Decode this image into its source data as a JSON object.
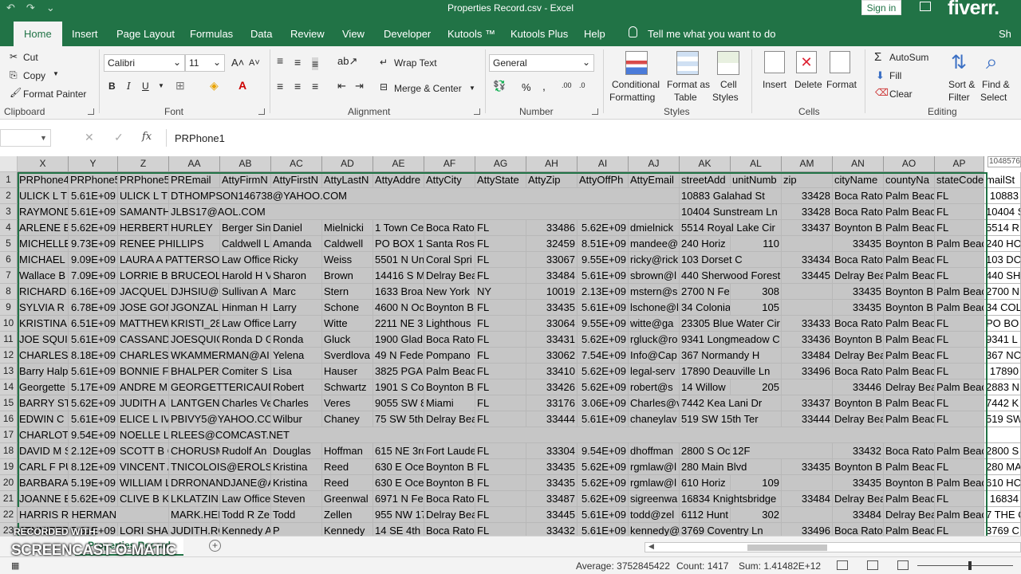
{
  "window": {
    "title": "Properties Record.csv  -  Excel",
    "signin": "Sign in",
    "brand_logo": "fiverr."
  },
  "tabs": [
    {
      "label": "Home",
      "active": true
    },
    {
      "label": "Insert"
    },
    {
      "label": "Page Layout"
    },
    {
      "label": "Formulas"
    },
    {
      "label": "Data"
    },
    {
      "label": "Review"
    },
    {
      "label": "View"
    },
    {
      "label": "Developer"
    },
    {
      "label": "Kutools ™"
    },
    {
      "label": "Kutools Plus"
    },
    {
      "label": "Help"
    }
  ],
  "tell_me": "Tell me what you want to do",
  "share": "Sh",
  "ribbon": {
    "clipboard": {
      "label": "Clipboard",
      "cut": "Cut",
      "copy": "Copy",
      "format_painter": "Format Painter"
    },
    "font": {
      "label": "Font",
      "name": "Calibri",
      "size": "11",
      "bold": "B",
      "italic": "I",
      "underline": "U"
    },
    "alignment": {
      "label": "Alignment",
      "wrap": "Wrap Text",
      "merge": "Merge & Center"
    },
    "number": {
      "label": "Number",
      "format": "General",
      "percent": "%",
      "comma": ","
    },
    "styles": {
      "label": "Styles",
      "conditional": "Conditional",
      "conditional2": "Formatting",
      "format_as": "Format as",
      "format_as2": "Table",
      "cell_styles": "Cell",
      "cell_styles2": "Styles"
    },
    "cells": {
      "label": "Cells",
      "insert": "Insert",
      "delete": "Delete",
      "format": "Format"
    },
    "editing": {
      "label": "Editing",
      "autosum": "AutoSum",
      "fill": "Fill",
      "clear": "Clear",
      "sort": "Sort &",
      "sort2": "Filter",
      "find": "Find &",
      "find2": "Select"
    }
  },
  "formula_bar": {
    "fx": "fx",
    "value": "PRPhone1"
  },
  "columns": [
    "X",
    "Y",
    "Z",
    "AA",
    "AB",
    "AC",
    "AD",
    "AE",
    "AF",
    "AG",
    "AH",
    "AI",
    "AJ",
    "AK",
    "AL",
    "AM",
    "AN",
    "AO",
    "AP"
  ],
  "rows": [
    {
      "n": "1",
      "c": [
        "PRPhone4",
        "PRPhone5",
        "PRPhone5",
        "PREmail",
        "AttyFirmN",
        "AttyFirstN",
        "AttyLastN",
        "AttyAddre",
        "AttyCity",
        "AttyState",
        "AttyZip",
        "AttyOffPh",
        "AttyEmail",
        "streetAdd",
        "unitNumb",
        "zip",
        "cityName",
        "countyNa",
        "stateCode",
        "mailSt"
      ]
    },
    {
      "n": "2",
      "c": [
        "ULICK L TH",
        "5.61E+09",
        "ULICK L TH",
        "DTHOMPSON146738@YAHOO.COM",
        "",
        "",
        "",
        "",
        "",
        "",
        "",
        "",
        "",
        "10883 Galahad St",
        "",
        "33428",
        "Boca Rato",
        "Palm Beac",
        "FL",
        "10883"
      ]
    },
    {
      "n": "3",
      "c": [
        "RAYMOND",
        "5.61E+09",
        "SAMANTH",
        "JLBS17@AOL.COM",
        "",
        "",
        "",
        "",
        "",
        "",
        "",
        "",
        "",
        "10404 Sunstream Ln",
        "",
        "33428",
        "Boca Rato",
        "Palm Beac",
        "FL",
        "10404 S"
      ]
    },
    {
      "n": "4",
      "c": [
        "ARLENE B",
        "5.62E+09",
        "HERBERT C",
        "HURLEY",
        "Berger Sin",
        "Daniel",
        "Mielnicki",
        "1 Town Ce",
        "Boca Rato",
        "FL",
        "33486",
        "5.62E+09",
        "dmielnick",
        "5514 Royal Lake Cir",
        "",
        "33437",
        "Boynton B",
        "Palm Beac",
        "FL",
        "5514 R"
      ]
    },
    {
      "n": "5",
      "c": [
        "MICHELLE",
        "9.73E+09",
        "RENEE PHILLIPS",
        "",
        "Caldwell L",
        "Amanda",
        "Caldwell",
        "PO BOX 18",
        "Santa Ros",
        "FL",
        "32459",
        "8.51E+09",
        "mandee@",
        "240 Horiz",
        "110",
        "",
        "33435",
        "Boynton B",
        "Palm Beac",
        "FL",
        "240 HO"
      ]
    },
    {
      "n": "6",
      "c": [
        "MICHAEL S",
        "9.09E+09",
        "LAURA A PATTERSON",
        "",
        "Law Office",
        "Ricky",
        "Weiss",
        "5501 N Un",
        "Coral Spri",
        "FL",
        "33067",
        "9.55E+09",
        "ricky@rick",
        "103 Dorset C",
        "",
        "33434",
        "Boca Rato",
        "Palm Beac",
        "FL",
        "103 DC"
      ]
    },
    {
      "n": "7",
      "c": [
        "Wallace B",
        "7.09E+09",
        "LORRIE B BRUCEOLS",
        "",
        "Harold H V",
        "Sharon",
        "Brown",
        "14416 S M",
        "Delray Bea",
        "FL",
        "33484",
        "5.61E+09",
        "sbrown@l",
        "440 Sherwood Forest",
        "",
        "33445",
        "Delray Bea",
        "Palm Beac",
        "FL",
        "440 SH"
      ]
    },
    {
      "n": "8",
      "c": [
        "RICHARD V",
        "6.16E+09",
        "JACQUELI",
        "DJHSIU@C",
        "Sullivan A",
        "Marc",
        "Stern",
        "1633 Broa",
        "New York",
        "NY",
        "10019",
        "2.13E+09",
        "mstern@s",
        "2700 N Fe",
        "308",
        "",
        "33435",
        "Boynton B",
        "Palm Beac",
        "FL",
        "2700 N"
      ]
    },
    {
      "n": "9",
      "c": [
        "SYLVIA R C",
        "6.78E+09",
        "JOSE GON",
        "JGONZALE",
        "Hinman H",
        "Larry",
        "Schone",
        "4600 N Oc",
        "Boynton B",
        "FL",
        "33435",
        "5.61E+09",
        "lschone@l",
        "34 Colonia",
        "105",
        "",
        "33435",
        "Boynton B",
        "Palm Beac",
        "FL",
        "34 COL"
      ]
    },
    {
      "n": "10",
      "c": [
        "KRISTINA",
        "6.51E+09",
        "MATTHEW",
        "KRISTI_28",
        "Law Office",
        "Larry",
        "Witte",
        "2211 NE 3",
        "Lighthous",
        "FL",
        "33064",
        "9.55E+09",
        "witte@ga",
        "23305 Blue Water Cir",
        "",
        "33433",
        "Boca Rato",
        "Palm Beac",
        "FL",
        "PO BO"
      ]
    },
    {
      "n": "11",
      "c": [
        "JOE SQUIC",
        "5.61E+09",
        "CASSANDI",
        "JOESQUIC",
        "Ronda D G",
        "Ronda",
        "Gluck",
        "1900 Glad",
        "Boca Rato",
        "FL",
        "33431",
        "5.62E+09",
        "rgluck@ro",
        "9341 Longmeadow C",
        "",
        "33436",
        "Boynton B",
        "Palm Beac",
        "FL",
        "9341 L"
      ]
    },
    {
      "n": "12",
      "c": [
        "CHARLES J",
        "8.18E+09",
        "CHARLES J",
        "WKAMMERMAN@AI",
        "",
        "Yelena",
        "Sverdlova",
        "49 N Fede",
        "Pompano",
        "FL",
        "33062",
        "7.54E+09",
        "Info@Cap",
        "367 Normandy H",
        "",
        "33484",
        "Delray Bea",
        "Palm Beac",
        "FL",
        "367 NC"
      ]
    },
    {
      "n": "13",
      "c": [
        "Barry Halp",
        "5.61E+09",
        "BONNIE F",
        "BHALPERI",
        "Comiter S",
        "Lisa",
        "Hauser",
        "3825 PGA",
        "Palm Beac",
        "FL",
        "33410",
        "5.62E+09",
        "legal-serv",
        "17890 Deauville Ln",
        "",
        "33496",
        "Boca Rato",
        "Palm Beac",
        "FL",
        "17890"
      ]
    },
    {
      "n": "14",
      "c": [
        "Georgette",
        "5.17E+09",
        "ANDRE M",
        "GEORGETTERICAUD@",
        "",
        "Robert",
        "Schwartz",
        "1901 S Cor",
        "Boynton B",
        "FL",
        "33426",
        "5.62E+09",
        "robert@s",
        "14 Willow",
        "205",
        "",
        "33446",
        "Delray Bea",
        "Palm Beac",
        "FL",
        "2883 N"
      ]
    },
    {
      "n": "15",
      "c": [
        "BARRY STE",
        "5.62E+09",
        "JUDITH A",
        "LANTGENI",
        "Charles Ve",
        "Charles",
        "Veres",
        "9055 SW 8",
        "Miami",
        "FL",
        "33176",
        "3.06E+09",
        "Charles@v",
        "7442 Kea Lani Dr",
        "",
        "33437",
        "Boynton B",
        "Palm Beac",
        "FL",
        "7442 K"
      ]
    },
    {
      "n": "16",
      "c": [
        "EDWIN C I",
        "5.61E+09",
        "ELICE L IVY",
        "PBIVY5@YAHOO.COM",
        "",
        "Wilbur",
        "Chaney",
        "75 SW 5th",
        "Delray Bea",
        "FL",
        "33444",
        "5.61E+09",
        "chaneylav",
        "519 SW 15th Ter",
        "",
        "33444",
        "Delray Bea",
        "Palm Beac",
        "FL",
        "519 SW"
      ]
    },
    {
      "n": "17",
      "c": [
        "CHARLOTT",
        "9.54E+09",
        "NOELLE LE",
        "RLEES@COMCAST.NET",
        "",
        "",
        "",
        "",
        "",
        "",
        "",
        "",
        "",
        "",
        "",
        "",
        "",
        "",
        "",
        ""
      ]
    },
    {
      "n": "18",
      "c": [
        "DAVID M S",
        "2.12E+09",
        "SCOTT B C",
        "CHORUSM",
        "Rudolf An",
        "Douglas",
        "Hoffman",
        "615 NE 3rc",
        "Fort Laude",
        "FL",
        "33304",
        "9.54E+09",
        "dhoffman",
        "2800 S Oce",
        "12F",
        "",
        "33432",
        "Boca Rato",
        "Palm Beac",
        "FL",
        "2800 S"
      ]
    },
    {
      "n": "19",
      "c": [
        "CARL F PU",
        "8.12E+09",
        "VINCENT A",
        "TNICOLOIS@EROLS.C",
        "",
        "Kristina",
        "Reed",
        "630 E Oce",
        "Boynton B",
        "FL",
        "33435",
        "5.62E+09",
        "rgmlaw@l",
        "280 Main Blvd",
        "",
        "33435",
        "Boynton B",
        "Palm Beac",
        "FL",
        "280 MA"
      ]
    },
    {
      "n": "20",
      "c": [
        "BARBARA",
        "5.19E+09",
        "WILLIAM L",
        "DRRONANDJANE@A",
        "",
        "Kristina",
        "Reed",
        "630 E Oce",
        "Boynton B",
        "FL",
        "33435",
        "5.62E+09",
        "rgmlaw@l",
        "610 Horiz",
        "109",
        "",
        "33435",
        "Boynton B",
        "Palm Beac",
        "FL",
        "610 HC"
      ]
    },
    {
      "n": "21",
      "c": [
        "JOANNE E",
        "5.62E+09",
        "CLIVE B KL",
        "LKLATZIN",
        "Law Office",
        "Steven",
        "Greenwal",
        "6971 N Fe",
        "Boca Rato",
        "FL",
        "33487",
        "5.62E+09",
        "sigreenwa",
        "16834 Knightsbridge",
        "",
        "33484",
        "Delray Bea",
        "Palm Beac",
        "FL",
        "16834"
      ]
    },
    {
      "n": "22",
      "c": [
        "HARRIS R HERMAN",
        "",
        "",
        "MARK.HEF",
        "Todd R Ze",
        "Todd",
        "Zellen",
        "955 NW 17",
        "Delray Bea",
        "FL",
        "33445",
        "5.61E+09",
        "todd@zel",
        "6112 Hunt",
        "302",
        "",
        "33484",
        "Delray Bea",
        "Palm Beac",
        "FL",
        "7 THE C"
      ]
    },
    {
      "n": "23",
      "c": [
        "JENNIFER",
        "5.61E+09",
        "LORI SHAN",
        "JUDITH.RC",
        "Kennedy A",
        "P",
        "Kennedy",
        "14 SE 4th S",
        "Boca Rato",
        "FL",
        "33432",
        "5.61E+09",
        "kennedy@",
        "3769 Coventry Ln",
        "",
        "33496",
        "Boca Rato",
        "Palm Beac",
        "FL",
        "3769 C"
      ]
    }
  ],
  "scroll_tip": "1048576",
  "sheet": {
    "name": "Properties Record",
    "add": "+"
  },
  "watermark": {
    "line1": "RECORDED WITH",
    "line2": "SCREENCAST-O-MATIC"
  },
  "status": {
    "average": "Average: 3752845422",
    "count": "Count: 1417",
    "sum": "Sum: 1.41482E+12"
  }
}
